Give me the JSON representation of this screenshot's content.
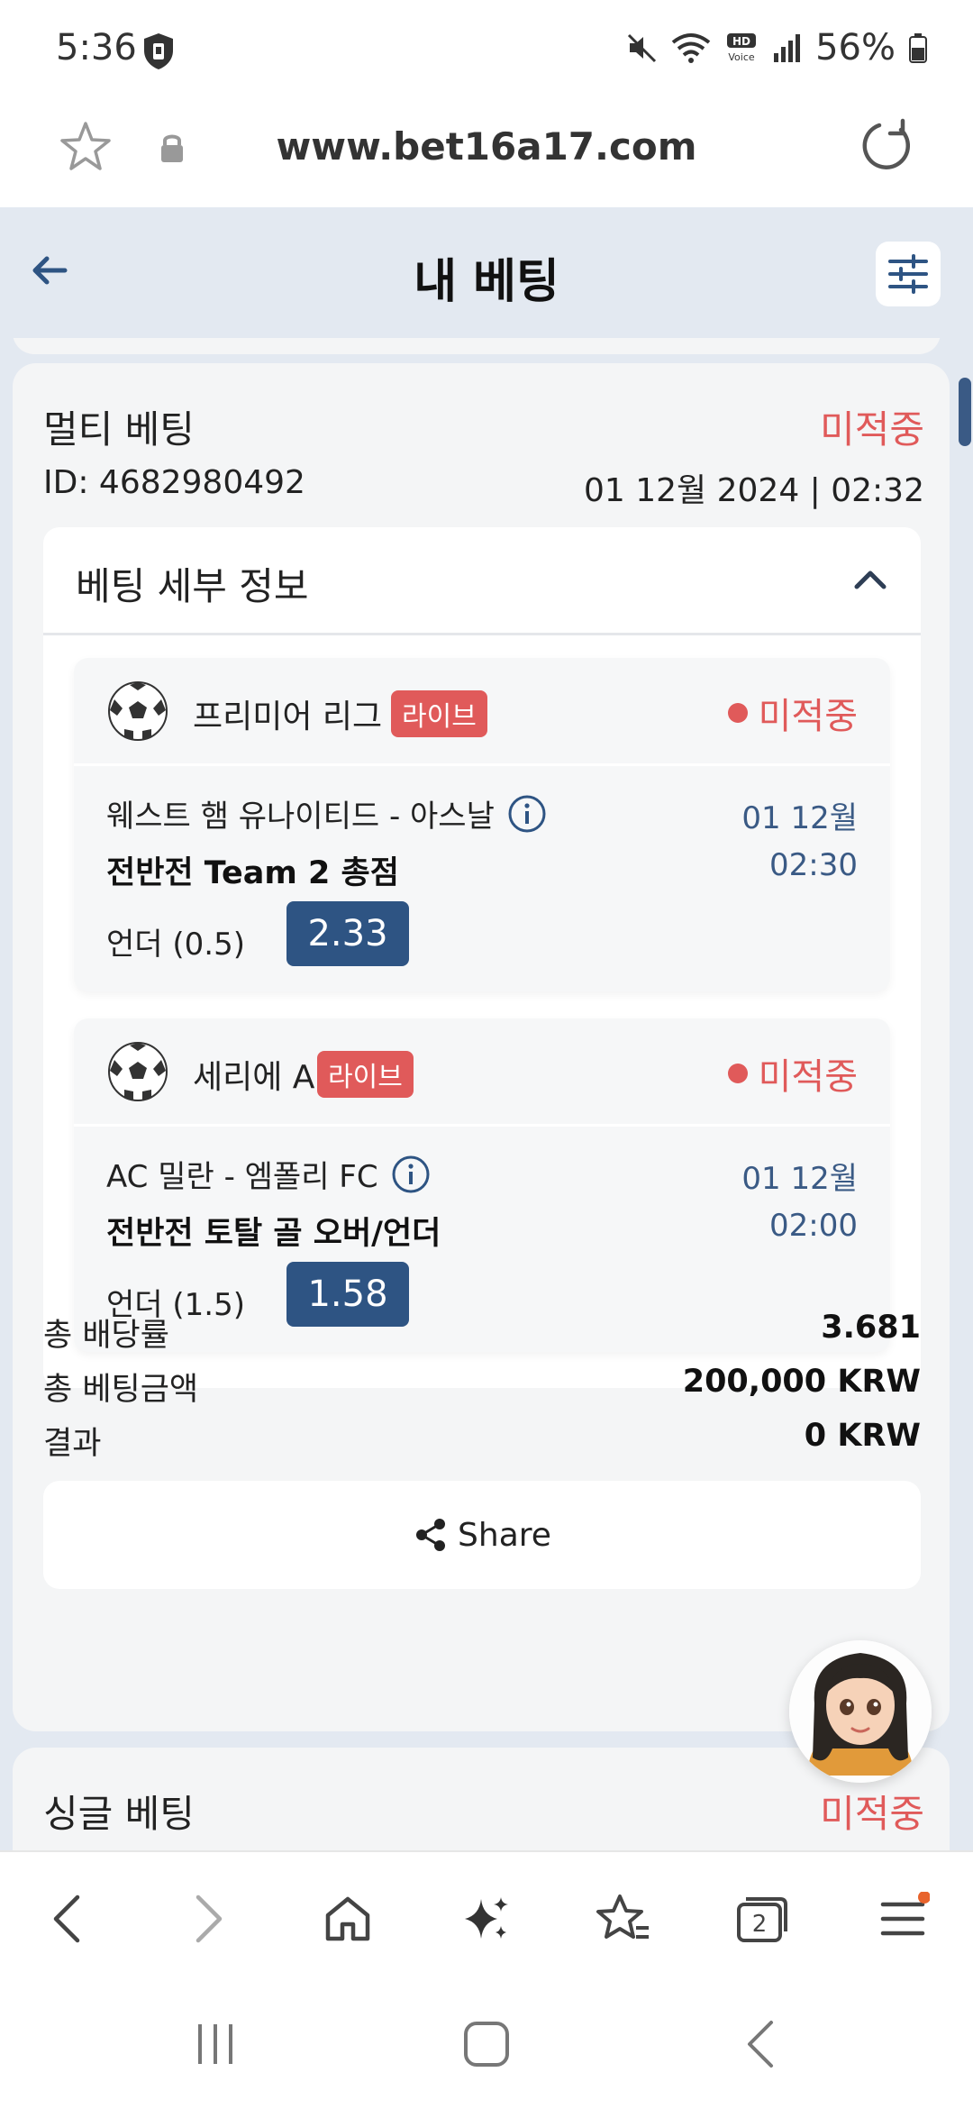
{
  "status_bar": {
    "time": "5:36",
    "battery": "56%"
  },
  "browser": {
    "url": "www.bet16a17.com",
    "tab_count": "2"
  },
  "header": {
    "title": "내 베팅"
  },
  "bet": {
    "type": "멀티 베팅",
    "status": "미적중",
    "id": "ID: 4682980492",
    "date": "01 12월 2024 | 02:32",
    "details_title": "베팅 세부 정보",
    "selections": [
      {
        "league": "프리미어 리그",
        "live": "라이브",
        "status": "미적중",
        "match": "웨스트 햄 유나이티드 - 아스날",
        "market": "전반전 Team 2 총점",
        "date": "01 12월",
        "time": "02:30",
        "pick": "언더 (0.5)",
        "odds": "2.33"
      },
      {
        "league": "세리에 A",
        "live": "라이브",
        "status": "미적중",
        "match": "AC 밀란 - 엠폴리 FC",
        "market": "전반전 토탈 골 오버/언더",
        "date": "01 12월",
        "time": "02:00",
        "pick": "언더 (1.5)",
        "odds": "1.58"
      }
    ],
    "summary": {
      "total_odds_label": "총 배당률",
      "total_odds": "3.681",
      "total_stake_label": "총 베팅금액",
      "total_stake": "200,000 KRW",
      "result_label": "결과",
      "result": "0 KRW"
    },
    "share_label": "Share"
  },
  "next_bet": {
    "type": "싱글 베팅",
    "status": "미적중"
  },
  "colors": {
    "accent": "#2e5483",
    "lost": "#e05a5a",
    "header_bg": "#e3e9f1"
  }
}
